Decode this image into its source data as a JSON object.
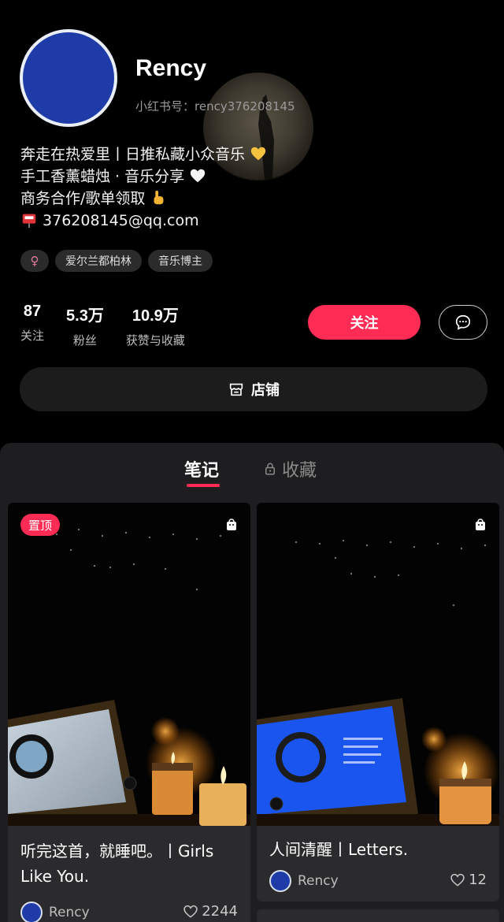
{
  "profile": {
    "name": "Rency",
    "red_id": "小红书号：rency376208145",
    "bio": [
      "奔走在热爱里丨日推私藏小众音乐",
      "手工香薰蜡烛 · 音乐分享",
      "商务合作/歌单领取",
      "376208145@qq.com"
    ],
    "bio_emojis": [
      "yellow-heart-icon",
      "white-heart-icon",
      "pointing-down-icon",
      "mailbox-icon"
    ],
    "tags": [
      "♀",
      "爱尔兰都柏林",
      "音乐博主"
    ],
    "stats": [
      {
        "value": "87",
        "label": "关注"
      },
      {
        "value": "5.3万",
        "label": "粉丝"
      },
      {
        "value": "10.9万",
        "label": "获赞与收藏"
      }
    ],
    "follow_label": "关注",
    "shop_label": "店铺"
  },
  "tabs": {
    "notes": "笔记",
    "collections": "收藏"
  },
  "notes": [
    {
      "pinned_label": "置顶",
      "title": "听完这首，就睡吧。丨Girls Like You.",
      "author": "Rency",
      "likes": "2244"
    },
    {
      "title": "人间清醒丨Letters.",
      "author": "Rency",
      "likes": "12"
    }
  ],
  "colors": {
    "accent": "#fe2c55",
    "background": "#000000",
    "panel": "#1e1e20",
    "card": "#2b2b2d",
    "avatar": "#1e3ba8"
  }
}
